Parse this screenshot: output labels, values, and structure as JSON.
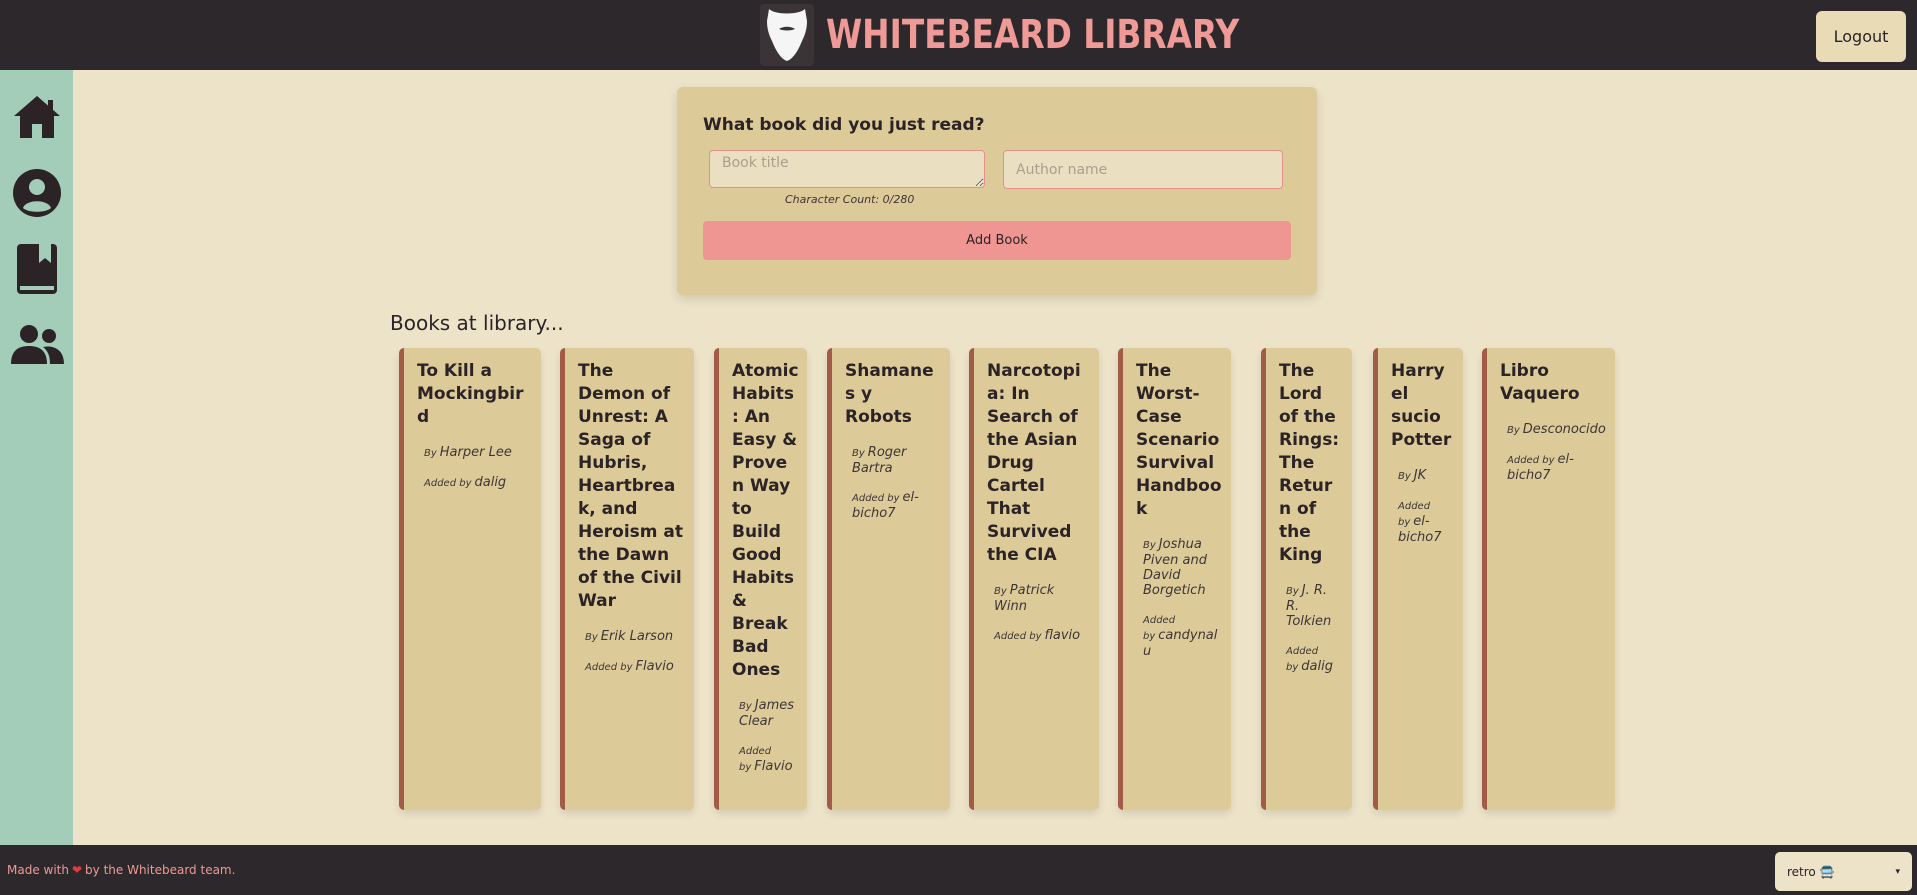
{
  "header": {
    "title": "WHITEBEARD LIBRARY",
    "logout_label": "Logout",
    "title_color": "#ef9a97",
    "bg_color": "#2d282b"
  },
  "sidebar": {
    "bg_color": "#a3cdb8",
    "items": [
      {
        "icon": "home-icon"
      },
      {
        "icon": "user-profile-icon"
      },
      {
        "icon": "book-icon"
      },
      {
        "icon": "users-group-icon"
      }
    ]
  },
  "form": {
    "heading": "What book did you just read?",
    "title_placeholder": "Book title",
    "title_value": "",
    "author_placeholder": "Author name",
    "author_value": "",
    "char_count": "Character Count: 0/280",
    "submit_label": "Add Book"
  },
  "books_heading": "Books at library...",
  "by_prefix": "By",
  "added_prefix": "Added by",
  "books": [
    {
      "title": "To Kill a Mockingbird",
      "author": "Harper Lee",
      "added_by": "dalig"
    },
    {
      "title": "The Demon of Unrest: A Saga of Hubris, Heartbreak, and Heroism at the Dawn of the Civil War",
      "author": "Erik Larson",
      "added_by": "Flavio"
    },
    {
      "title": "Atomic Habits: An Easy & Proven Way to Build Good Habits & Break Bad Ones",
      "author": "James Clear",
      "added_by": "Flavio"
    },
    {
      "title": "Shamanes y Robots",
      "author": "Roger Bartra",
      "added_by": "el-bicho7"
    },
    {
      "title": "Narcotopia: In Search of the Asian Drug Cartel That Survived the CIA",
      "author": "Patrick Winn",
      "added_by": "flavio"
    },
    {
      "title": "The Worst-Case Scenario Survival Handbook",
      "author": "Joshua Piven and David Borgetich",
      "added_by": "candynalu"
    },
    {
      "title": "The Lord of the Rings: The Return of the King",
      "author": "J. R. R. Tolkien",
      "added_by": "dalig"
    },
    {
      "title": "Harry el sucio Potter",
      "author": "JK",
      "added_by": "el-bicho7"
    },
    {
      "title": "Libro Vaquero",
      "author": "Desconocido",
      "added_by": "el-bicho7"
    }
  ],
  "footer": {
    "prefix": "Made with",
    "suffix": "by the Whitebeard team.",
    "heart_icon": "heart-icon"
  },
  "theme_select": {
    "value": "retro 🚍"
  }
}
